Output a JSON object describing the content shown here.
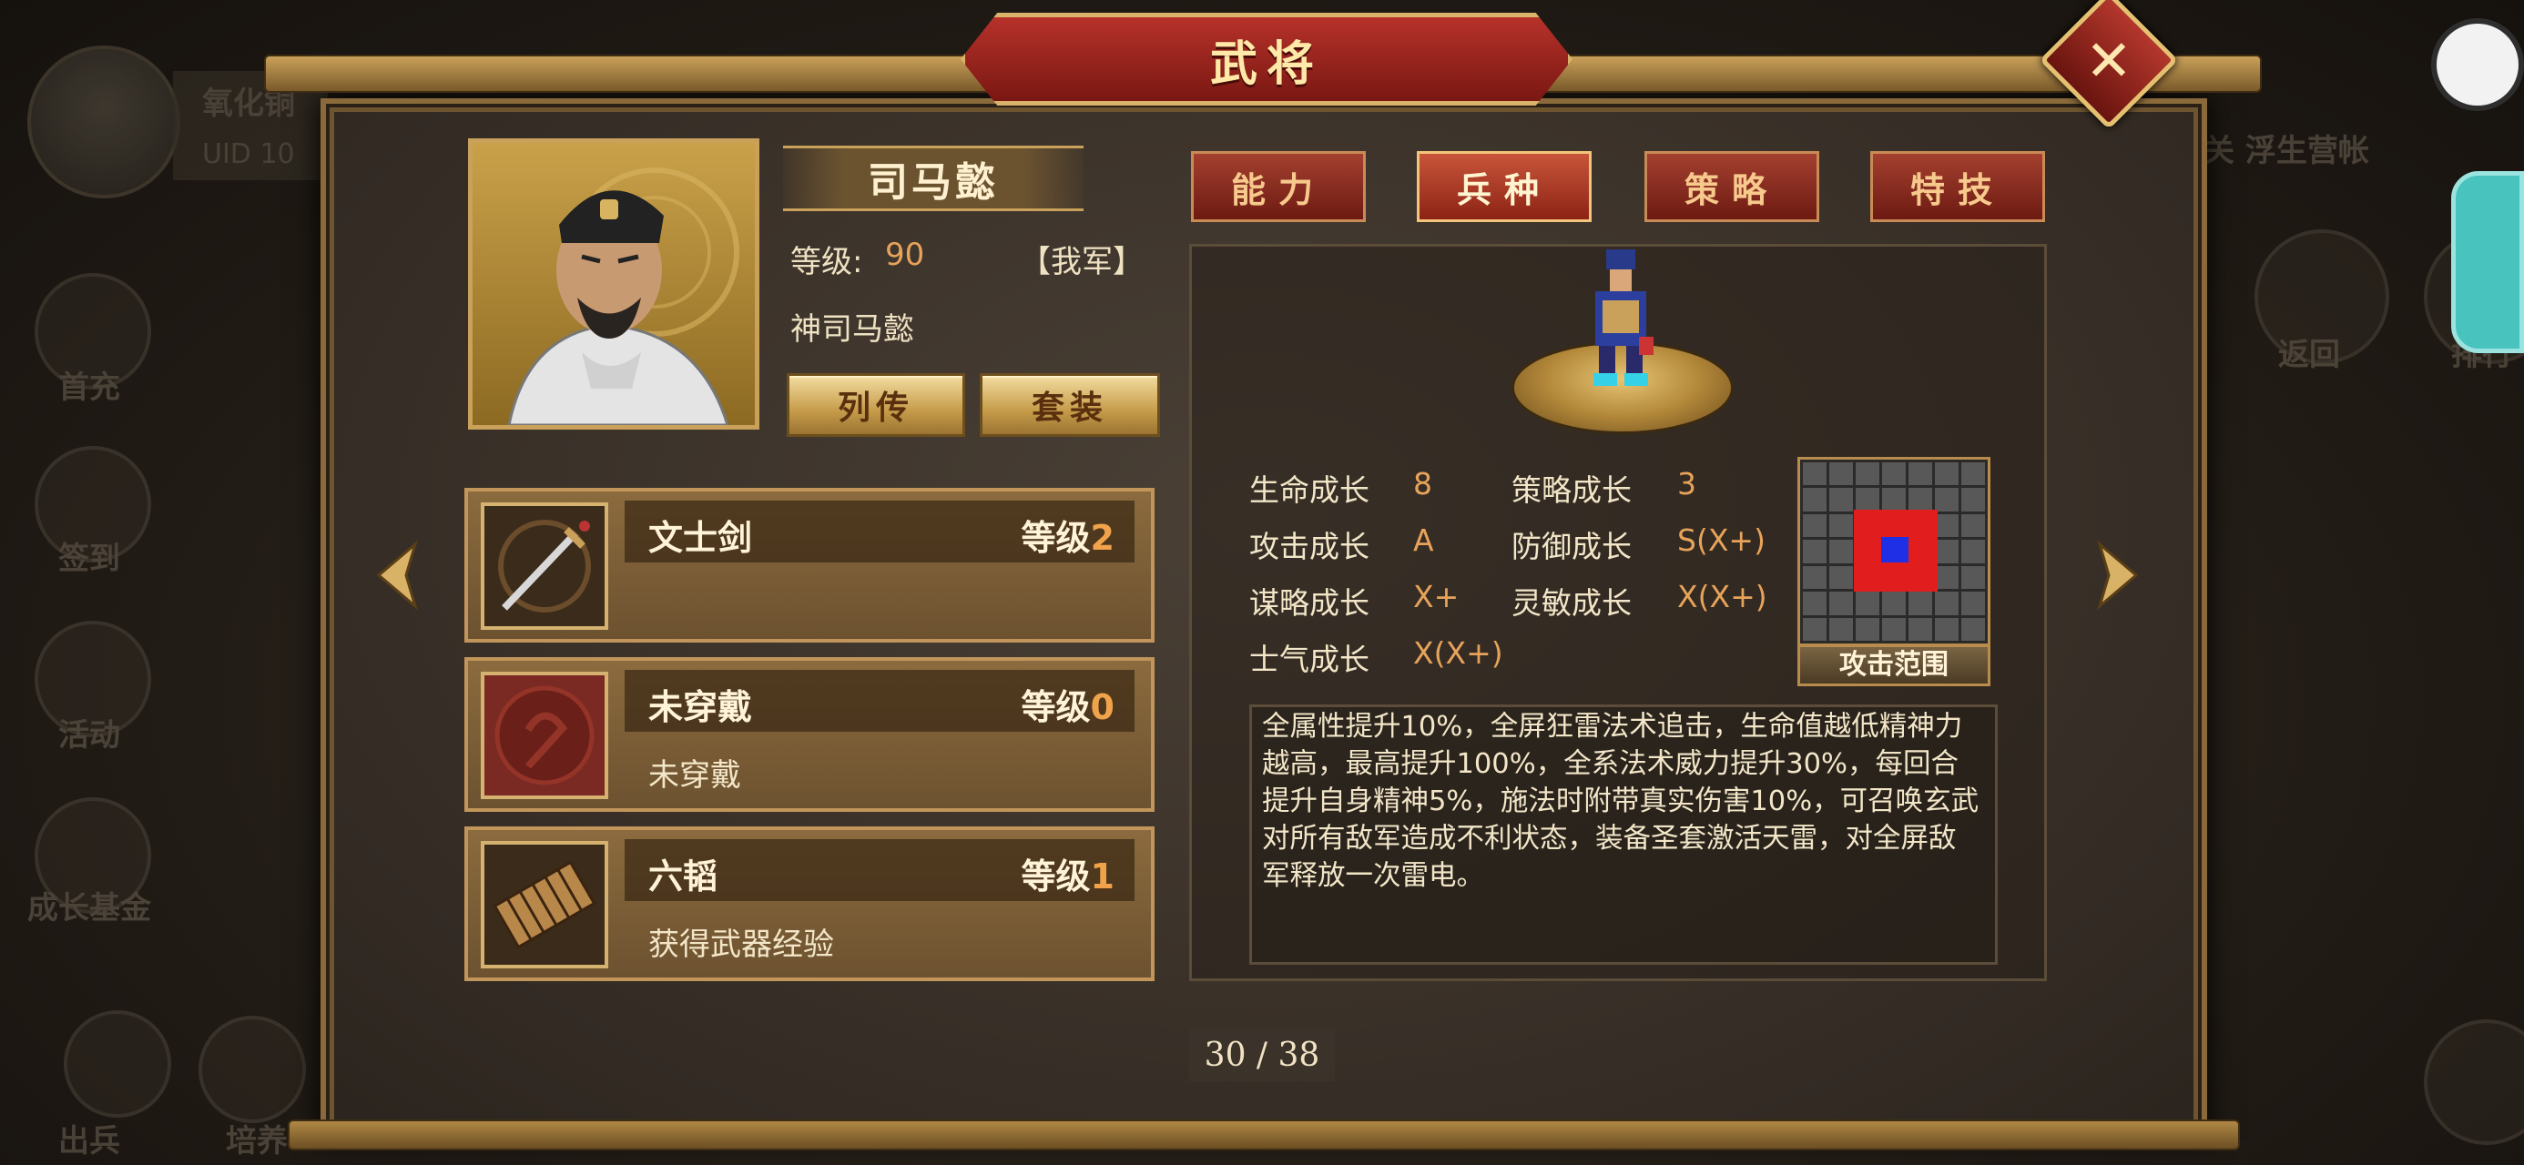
{
  "window": {
    "title": "武将"
  },
  "background": {
    "player_name": "氧化铜",
    "uid_label": "UID 10",
    "left_menu": [
      "首充",
      "签到",
      "活动",
      "成长基金",
      "出兵",
      "培养"
    ],
    "right_top_text": "关 浮生营帐",
    "right_buttons": [
      "返回",
      "排行"
    ]
  },
  "general": {
    "name": "司马懿",
    "level_label": "等级:",
    "level_value": "90",
    "faction": "【我军】",
    "title": "神司马懿",
    "buttons": {
      "biography": "列传",
      "set": "套装"
    }
  },
  "equipment": [
    {
      "name": "文士剑",
      "level_label": "等级",
      "level": "2",
      "desc": "",
      "icon": "sword-icon"
    },
    {
      "name": "未穿戴",
      "level_label": "等级",
      "level": "0",
      "desc": "未穿戴",
      "icon": "empty-slot-icon"
    },
    {
      "name": "六韬",
      "level_label": "等级",
      "level": "1",
      "desc": "获得武器经验",
      "icon": "scroll-icon"
    }
  ],
  "tabs": [
    {
      "label": "能力",
      "active": false
    },
    {
      "label": "兵种",
      "active": true
    },
    {
      "label": "策略",
      "active": false
    },
    {
      "label": "特技",
      "active": false
    }
  ],
  "growth": [
    {
      "label": "生命成长",
      "value": "8"
    },
    {
      "label": "策略成长",
      "value": "3"
    },
    {
      "label": "攻击成长",
      "value": "A"
    },
    {
      "label": "防御成长",
      "value": "S(X+)"
    },
    {
      "label": "谋略成长",
      "value": "X+"
    },
    {
      "label": "灵敏成长",
      "value": "X(X+)"
    },
    {
      "label": "士气成长",
      "value": "X(X+)"
    }
  ],
  "attack_range": {
    "label": "攻击范围"
  },
  "skill_description": "全属性提升10%，全屏狂雷法术追击，生命值越低精神力越高，最高提升100%，全系法术威力提升30%，每回合提升自身精神5%，施法时附带真实伤害10%，可召唤玄武对所有敌军造成不利状态，装备圣套激活天雷，对全屏敌军释放一次雷电。",
  "pager": {
    "text": "30 / 38"
  },
  "colors": {
    "accent_gold": "#c9a15a",
    "tab_red": "#8d2315",
    "highlight_orange": "#e8a35a"
  }
}
